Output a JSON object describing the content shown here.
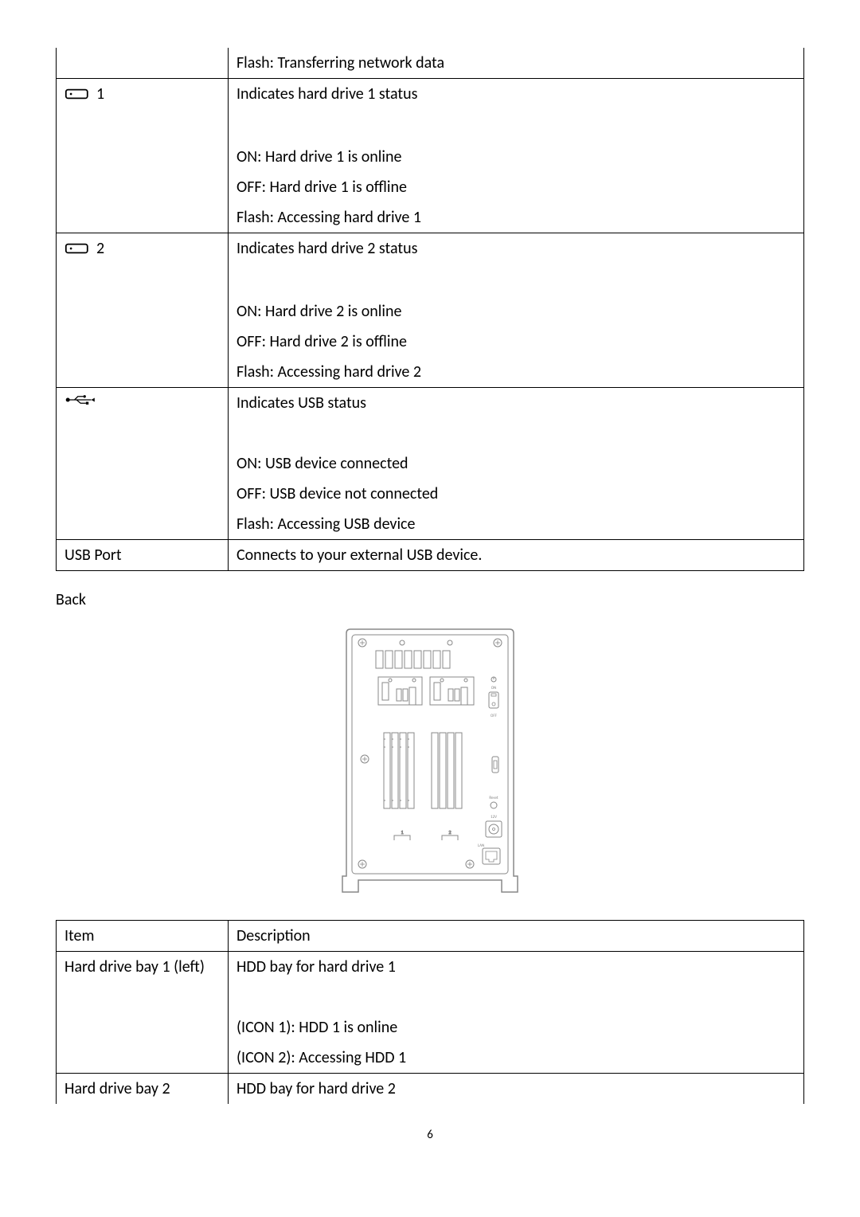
{
  "table1": {
    "rows": [
      {
        "icon": "",
        "desc": "Flash: Transferring network data"
      },
      {
        "icon": "hdd1",
        "desc": "Indicates hard drive 1 status"
      },
      {
        "icon": "",
        "desc": "ON: Hard drive 1 is online"
      },
      {
        "icon": "",
        "desc": "OFF: Hard drive 1 is offline"
      },
      {
        "icon": "",
        "desc": "Flash: Accessing hard drive 1"
      },
      {
        "icon": "hdd2",
        "desc": "Indicates hard drive 2 status"
      },
      {
        "icon": "",
        "desc": "ON: Hard drive 2 is online"
      },
      {
        "icon": "",
        "desc": "OFF: Hard drive 2 is offline"
      },
      {
        "icon": "",
        "desc": "Flash: Accessing hard drive 2"
      },
      {
        "icon": "usb",
        "desc": "Indicates USB status"
      },
      {
        "icon": "",
        "desc": "ON: USB device connected"
      },
      {
        "icon": "",
        "desc": "OFF: USB device not connected"
      },
      {
        "icon": "",
        "desc": "Flash: Accessing USB device"
      },
      {
        "icon": "usbport",
        "icon_text": "USB Port",
        "desc": "Connects to your external USB device."
      }
    ]
  },
  "heading_back": "Back",
  "diagram": {
    "labels": {
      "on": "ON",
      "off": "OFF",
      "reset": "Reset",
      "v12": "12V",
      "lan": "LAN",
      "bay1": "1",
      "bay2": "2"
    }
  },
  "table2": {
    "header": {
      "item": "Item",
      "desc": "Description"
    },
    "rows": [
      {
        "item": "Hard drive bay 1 (left)",
        "desc": "HDD bay for hard drive 1"
      },
      {
        "item": "",
        "desc": "(ICON 1): HDD 1 is online"
      },
      {
        "item": "",
        "desc": "(ICON 2): Accessing HDD 1"
      },
      {
        "item": "Hard drive bay 2",
        "desc": "HDD bay for hard drive 2"
      }
    ]
  },
  "page_number": "6",
  "hdd1_num": "1",
  "hdd2_num": "2"
}
